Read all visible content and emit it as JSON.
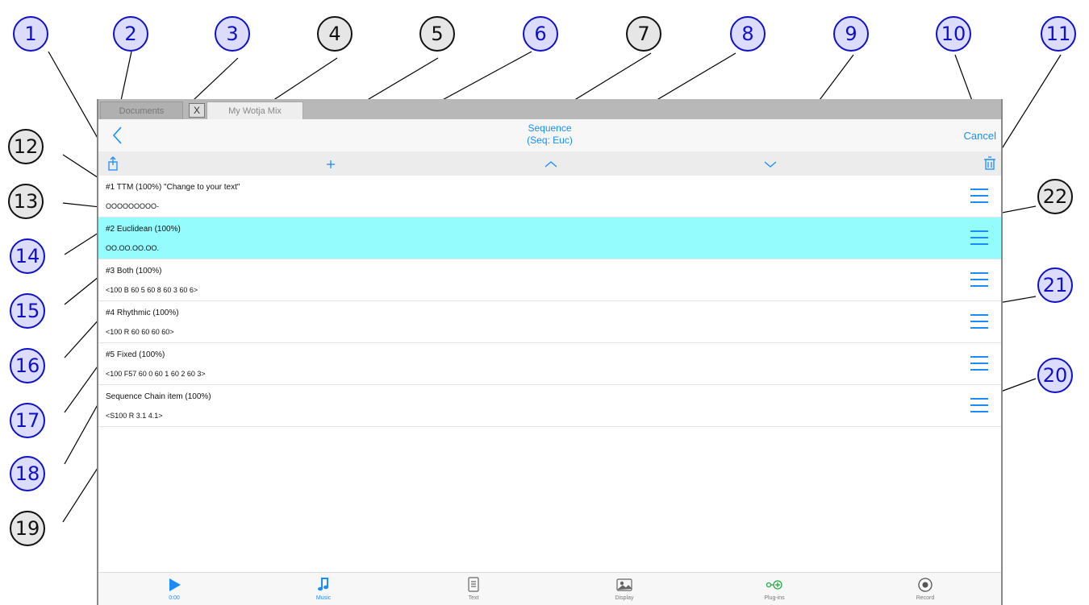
{
  "tabs": {
    "documents": "Documents",
    "close": "X",
    "active": "My Wotja Mix"
  },
  "nav": {
    "title_line1": "Sequence",
    "title_line2": "(Seq: Euc)",
    "cancel": "Cancel"
  },
  "rows": [
    {
      "title": "#1 TTM (100%) \"Change to your text\"",
      "pattern": "OOOOOOOOO-"
    },
    {
      "title": "#2 Euclidean (100%)",
      "pattern": "OO.OO.OO.OO."
    },
    {
      "title": "#3 Both (100%)",
      "pattern": "<100 B 60 5 60 8 60 3 60 6>"
    },
    {
      "title": "#4 Rhythmic (100%)",
      "pattern": "<100 R 60 60 60 60>"
    },
    {
      "title": "#5 Fixed (100%)",
      "pattern": "<100 F57 60 0 60 1 60 2 60 3>"
    },
    {
      "title": "Sequence Chain item (100%)",
      "pattern": "<S100 R 3.1 4.1>"
    }
  ],
  "bottom_tabs": [
    {
      "label": "0:00",
      "icon": "play-icon"
    },
    {
      "label": "Music",
      "icon": "music-note-icon"
    },
    {
      "label": "Text",
      "icon": "text-document-icon"
    },
    {
      "label": "Display",
      "icon": "image-icon"
    },
    {
      "label": "Plug-ins",
      "icon": "plugin-icon"
    },
    {
      "label": "Record",
      "icon": "record-icon"
    }
  ],
  "callouts": [
    "1",
    "2",
    "3",
    "4",
    "5",
    "6",
    "7",
    "8",
    "9",
    "10",
    "11",
    "12",
    "13",
    "14",
    "15",
    "16",
    "17",
    "18",
    "19",
    "20",
    "21",
    "22"
  ],
  "colors": {
    "accent": "#1a8cff",
    "selected_row": "#94fcfc",
    "callout_blue_fill": "#dcdcfe",
    "callout_blue_text": "#1010c8",
    "callout_gray_fill": "#e6e6e6"
  }
}
